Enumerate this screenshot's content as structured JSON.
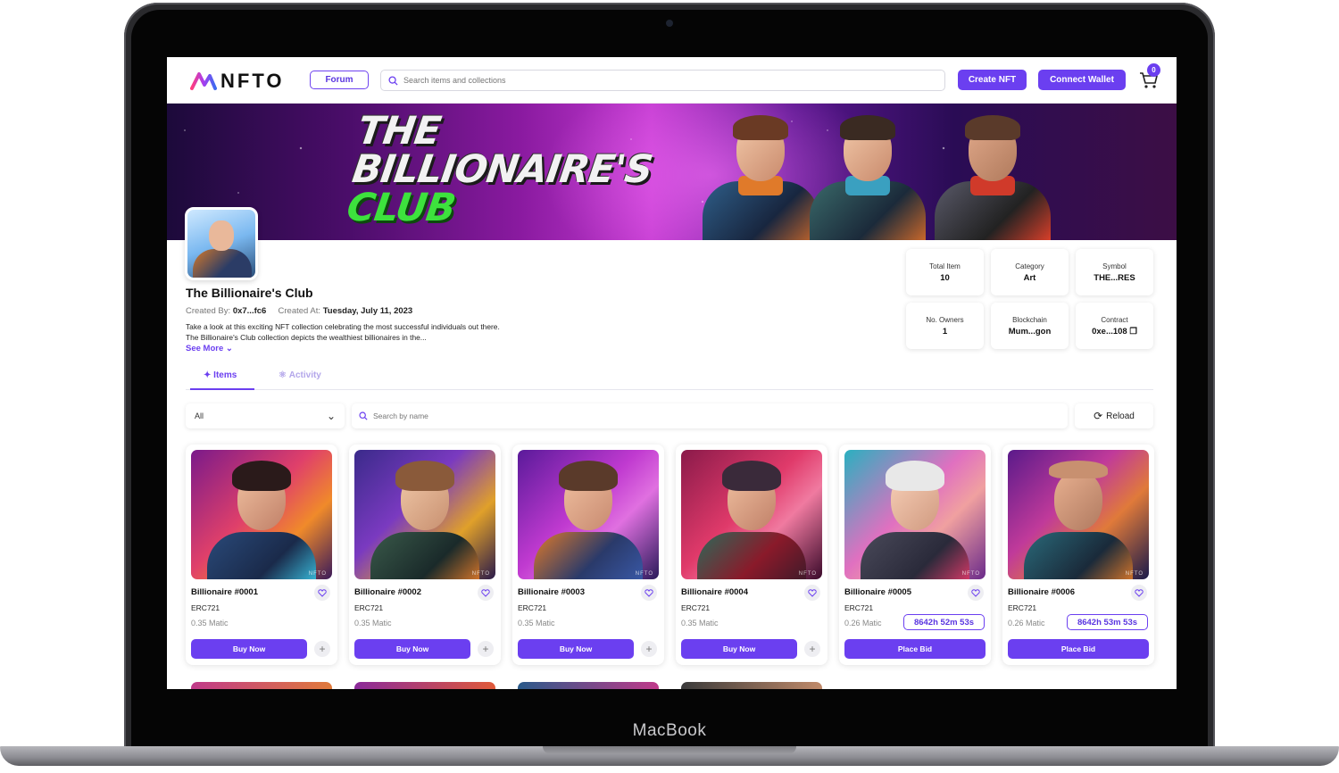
{
  "device": {
    "brand": "MacBook"
  },
  "header": {
    "logo_text": "NFTO",
    "forum_label": "Forum",
    "search_placeholder": "Search items and collections",
    "create_label": "Create NFT",
    "connect_label": "Connect Wallet",
    "cart_count": "0"
  },
  "banner": {
    "line1": "THE",
    "line2": "BILLIONAIRE'S",
    "line3": "CLUB"
  },
  "collection": {
    "name": "The Billionaire's Club",
    "created_by_label": "Created By:",
    "created_by": "0x7...fc6",
    "created_at_label": "Created At:",
    "created_at": "Tuesday, July 11, 2023",
    "description": "Take a look at this exciting NFT collection celebrating the most successful individuals out there. The Billionaire's Club collection depicts the wealthiest billionaires in the...",
    "see_more": "See More"
  },
  "stats": [
    {
      "label": "Total Item",
      "value": "10"
    },
    {
      "label": "Category",
      "value": "Art"
    },
    {
      "label": "Symbol",
      "value": "THE...RES"
    },
    {
      "label": "No. Owners",
      "value": "1"
    },
    {
      "label": "Blockchain",
      "value": "Mum...gon"
    },
    {
      "label": "Contract",
      "value": "0xe...108"
    }
  ],
  "tabs": {
    "items": "Items",
    "activity": "Activity"
  },
  "filters": {
    "select_value": "All",
    "search_placeholder": "Search by name",
    "reload_label": "Reload"
  },
  "cards": [
    {
      "title": "Billionaire #0001",
      "standard": "ERC721",
      "price": "0.35 Matic",
      "action": "Buy Now",
      "watermark": "NFTO"
    },
    {
      "title": "Billionaire #0002",
      "standard": "ERC721",
      "price": "0.35 Matic",
      "action": "Buy Now",
      "watermark": "NFTO"
    },
    {
      "title": "Billionaire #0003",
      "standard": "ERC721",
      "price": "0.35 Matic",
      "action": "Buy Now",
      "watermark": "NFTO"
    },
    {
      "title": "Billionaire #0004",
      "standard": "ERC721",
      "price": "0.35 Matic",
      "action": "Buy Now",
      "watermark": "NFTO"
    },
    {
      "title": "Billionaire #0005",
      "standard": "ERC721",
      "price": "0.26 Matic",
      "timer": "8642h 52m 53s",
      "action": "Place Bid",
      "watermark": "NFTO"
    },
    {
      "title": "Billionaire #0006",
      "standard": "ERC721",
      "price": "0.26 Matic",
      "timer": "8642h 53m 53s",
      "action": "Place Bid",
      "watermark": "NFTO"
    }
  ],
  "colors": {
    "accent": "#6b3ff0",
    "banner_magenta": "#c23ad0",
    "banner_green": "#3de23d"
  }
}
